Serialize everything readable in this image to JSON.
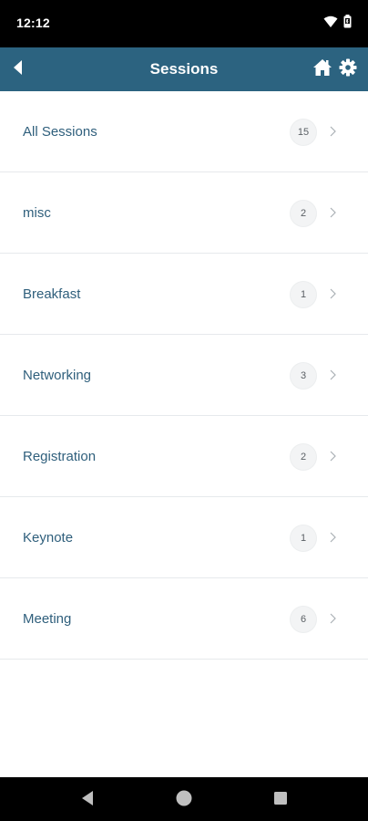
{
  "status_bar": {
    "time": "12:12",
    "icons": [
      "wifi-icon",
      "battery-icon"
    ]
  },
  "app_bar": {
    "title": "Sessions",
    "back_icon": "back-arrow-icon",
    "home_icon": "home-icon",
    "settings_icon": "gear-icon",
    "color": "#2c6380"
  },
  "sessions": [
    {
      "label": "All Sessions",
      "count": "15"
    },
    {
      "label": "misc",
      "count": "2"
    },
    {
      "label": "Breakfast",
      "count": "1"
    },
    {
      "label": "Networking",
      "count": "3"
    },
    {
      "label": "Registration",
      "count": "2"
    },
    {
      "label": "Keynote",
      "count": "1"
    },
    {
      "label": "Meeting",
      "count": "6"
    }
  ],
  "nav_bar": {
    "icons": [
      "back-triangle-icon",
      "home-circle-icon",
      "recents-square-icon"
    ]
  }
}
